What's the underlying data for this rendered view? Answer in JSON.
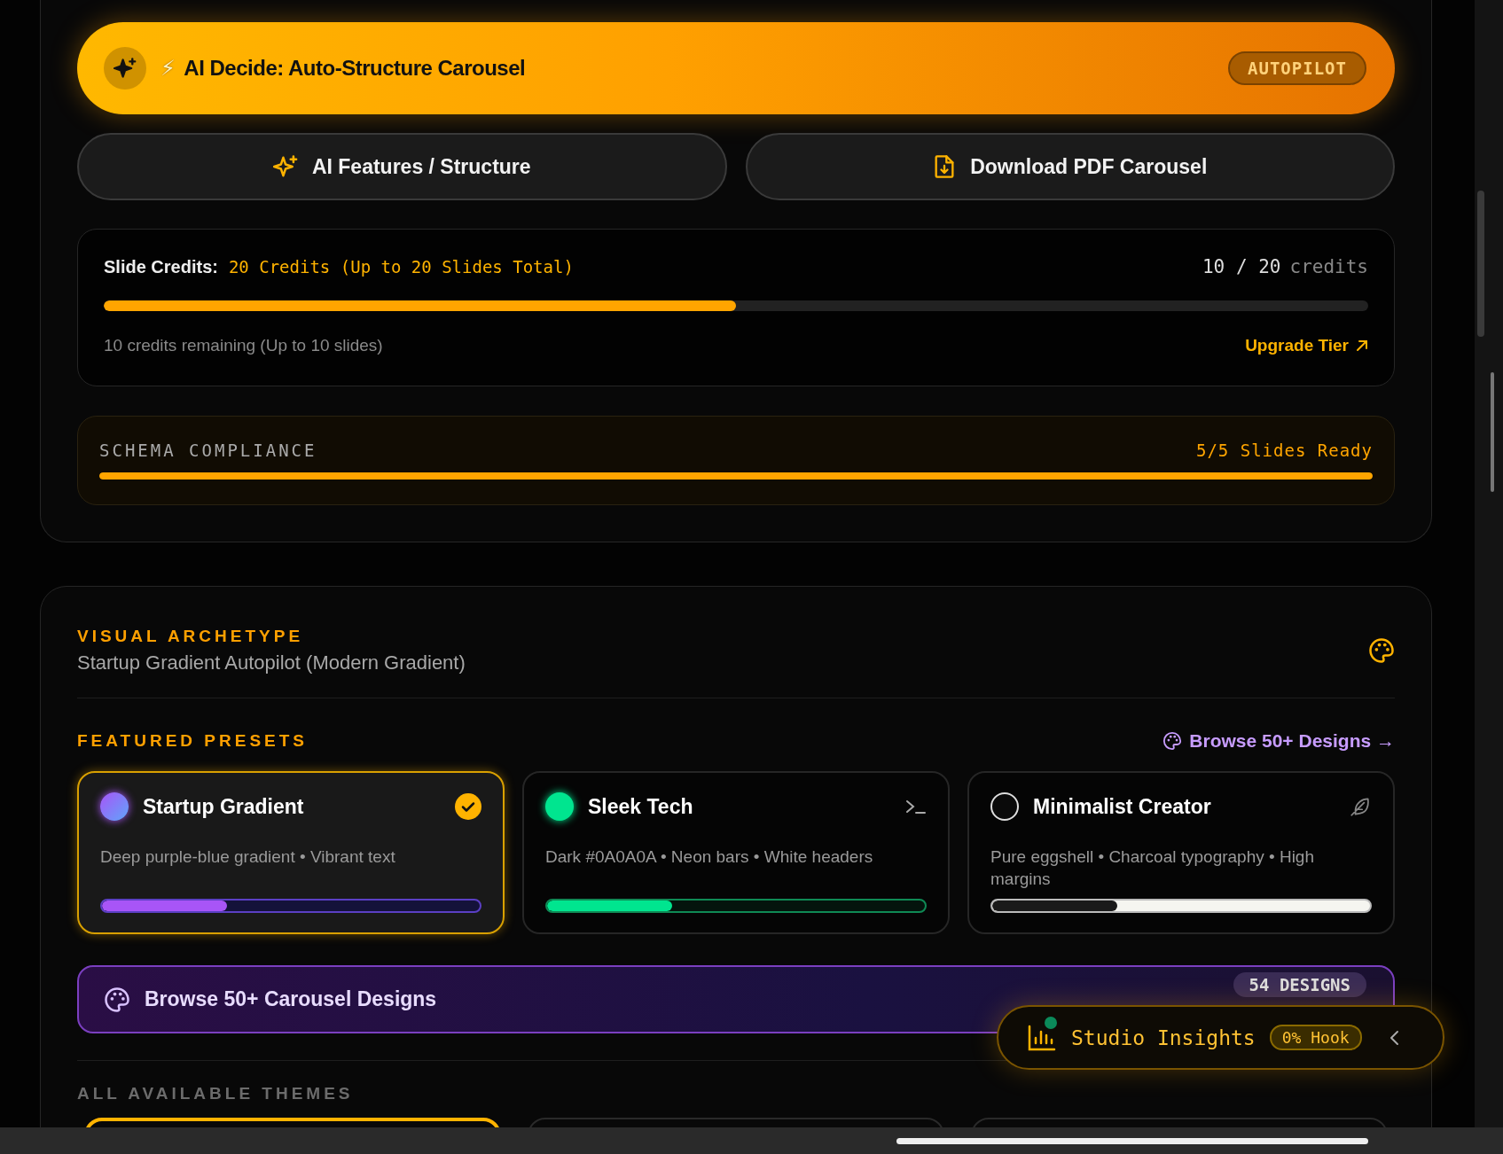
{
  "autopilot_banner": {
    "prefix": "⚡",
    "title": "AI Decide: Auto-Structure Carousel",
    "badge": "AUTOPILOT"
  },
  "action_buttons": [
    {
      "kind": "sparkles",
      "label": "AI Features / Structure"
    },
    {
      "kind": "download",
      "label": "Download PDF Carousel"
    }
  ],
  "credits": {
    "label": "Slide Credits:",
    "plan": "20 Credits (Up to 20 Slides Total)",
    "count": "10 / 20",
    "unit": "credits",
    "level": 0.5,
    "remaining": "10 credits remaining (Up to 10 slides)",
    "upgrade_link": "Upgrade Tier"
  },
  "schema_compliance": {
    "label": "SCHEMA COMPLIANCE",
    "status": "5/5 Slides Ready",
    "level": 1
  },
  "visual_archetype": {
    "label": "VISUAL ARCHETYPE",
    "value": "Startup Gradient Autopilot (Modern Gradient)"
  },
  "featured_presets": {
    "label": "FEATURED PRESETS",
    "browse_link": "Browse 50+ Designs →",
    "presets": [
      {
        "kind": "gradient",
        "name": "Startup Gradient",
        "description": "Deep purple-blue gradient • Vibrant text",
        "selected": true,
        "level": 0.33
      },
      {
        "kind": "neon",
        "name": "Sleek Tech",
        "description": "Dark #0A0A0A • Neon bars • White headers",
        "selected": false,
        "level": 0.33
      },
      {
        "kind": "minimal",
        "name": "Minimalist Creator",
        "description": "Pure eggshell • Charcoal typography • High margins",
        "selected": false,
        "level": 0.33
      }
    ]
  },
  "browse_banner": {
    "label": "Browse 50+ Carousel Designs",
    "badge": "54 DESIGNS"
  },
  "all_themes": {
    "label": "ALL AVAILABLE THEMES",
    "cards": [
      {
        "selected": true
      },
      {
        "selected": false
      },
      {
        "selected": false
      }
    ]
  },
  "insights": {
    "title": "Studio Insights",
    "badge": "0% Hook",
    "live": true
  }
}
